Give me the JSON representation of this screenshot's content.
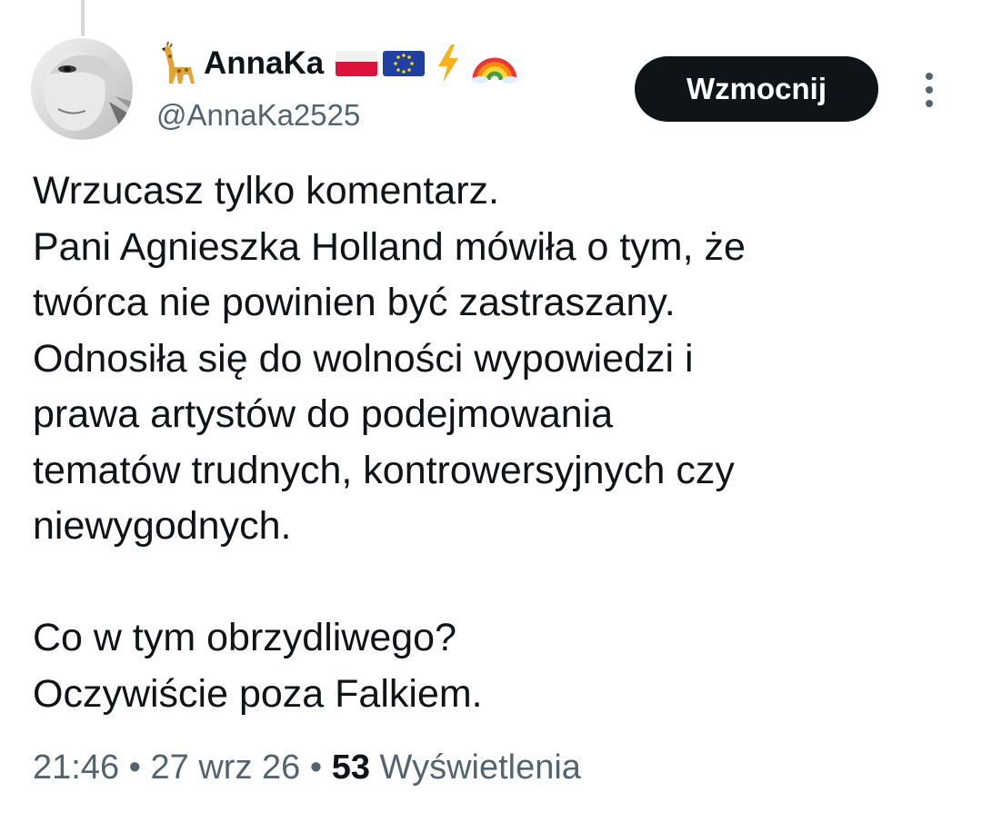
{
  "author": {
    "display_name": "AnnaKa",
    "handle": "@AnnaKa2525",
    "name_emojis": [
      "giraffe-emoji",
      "poland-flag-emoji",
      "eu-flag-emoji",
      "lightning-emoji",
      "rainbow-emoji"
    ]
  },
  "actions": {
    "boost_label": "Wzmocnij",
    "more_icon": "more-vertical-icon"
  },
  "tweet": {
    "lines": [
      "Wrzucasz tylko komentarz.",
      "Pani Agnieszka Holland mówiła o tym, że",
      "twórca nie powinien być zastraszany.",
      "Odnosiła się do wolności wypowiedzi i",
      "prawa artystów do podejmowania",
      "tematów trudnych, kontrowersyjnych czy",
      "niewygodnych.",
      "",
      "Co w tym obrzydliwego?",
      "Oczywiście poza Falkiem."
    ]
  },
  "meta": {
    "time": "21:46",
    "separator": " • ",
    "date": "27 wrz 26",
    "views_count": "53",
    "views_label": "Wyświetlenia"
  },
  "colors": {
    "text_primary": "#0f1419",
    "text_secondary": "#536471",
    "button_bg": "#0f1419",
    "button_text": "#ffffff"
  }
}
